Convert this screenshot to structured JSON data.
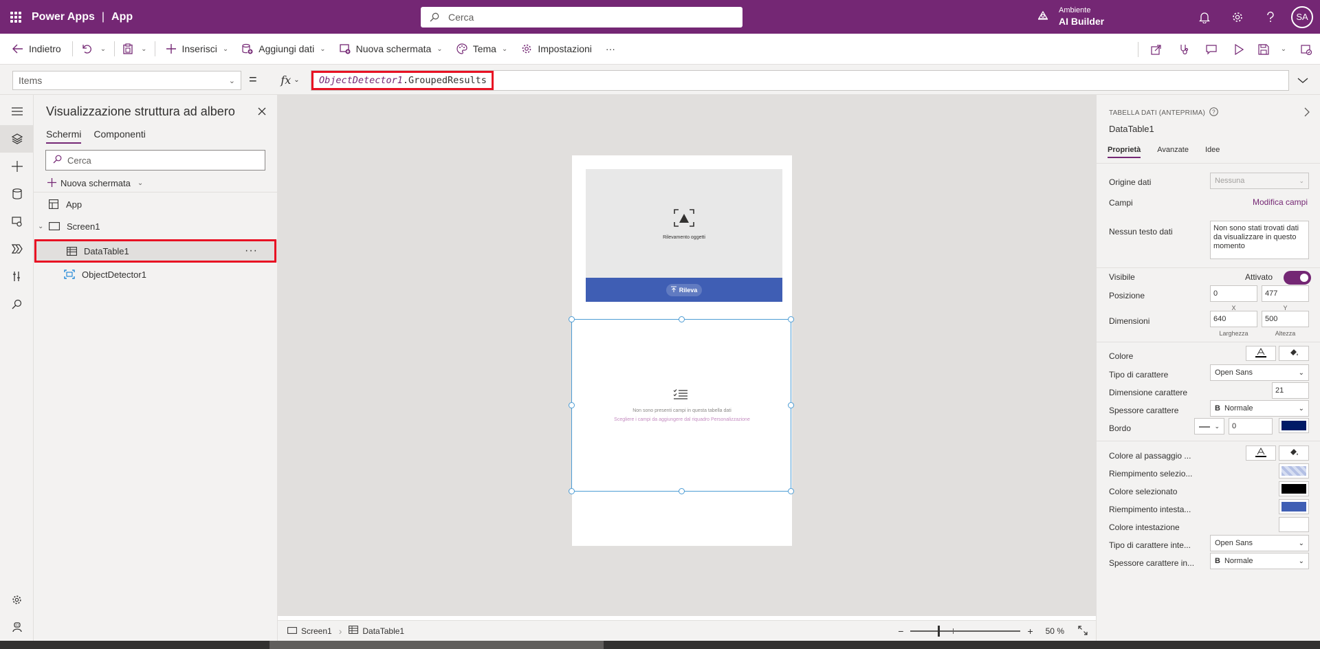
{
  "header": {
    "product": "Power Apps",
    "separator": "|",
    "app": "App",
    "search_placeholder": "Cerca",
    "environment_label": "Ambiente",
    "environment_name": "AI Builder",
    "user_initials": "SA"
  },
  "command_bar": {
    "back": "Indietro",
    "insert": "Inserisci",
    "add_data": "Aggiungi dati",
    "new_screen": "Nuova schermata",
    "theme": "Tema",
    "settings": "Impostazioni",
    "more": "···"
  },
  "formula_bar": {
    "property": "Items",
    "equals": "=",
    "fx": "fx",
    "formula_object": "ObjectDetector1",
    "formula_member": ".GroupedResults"
  },
  "tree": {
    "title": "Visualizzazione struttura ad albero",
    "tabs": [
      "Schermi",
      "Componenti"
    ],
    "search_placeholder": "Cerca",
    "new_screen": "Nuova schermata",
    "items": [
      {
        "label": "App"
      },
      {
        "label": "Screen1"
      },
      {
        "label": "DataTable1"
      },
      {
        "label": "ObjectDetector1"
      }
    ],
    "more": "···"
  },
  "canvas": {
    "detector_label": "Rilevamento oggetti",
    "detect_button": "Rileva",
    "empty_line1": "Non sono presenti campi in questa tabella dati",
    "empty_line2": "Scegliere i campi da aggiungere dal riquadro Personalizzazione"
  },
  "status_bar": {
    "screen": "Screen1",
    "control": "DataTable1",
    "zoom_minus": "−",
    "zoom_plus": "+",
    "zoom_value": "50",
    "zoom_unit": "%"
  },
  "properties": {
    "kind": "TABELLA DATI (ANTEPRIMA)",
    "name": "DataTable1",
    "tabs": [
      "Proprietà",
      "Avanzate",
      "Idee"
    ],
    "data_source_label": "Origine dati",
    "data_source_value": "Nessuna",
    "fields_label": "Campi",
    "fields_link": "Modifica campi",
    "no_data_label": "Nessun testo dati",
    "no_data_value": "Non sono stati trovati dati da visualizzare in questo momento",
    "visible_label": "Visibile",
    "visible_value": "Attivato",
    "position_label": "Posizione",
    "pos_x": "0",
    "pos_y": "477",
    "x_label": "X",
    "y_label": "Y",
    "size_label": "Dimensioni",
    "width": "640",
    "height": "500",
    "width_label": "Larghezza",
    "height_label": "Altezza",
    "color_label": "Colore",
    "font_label": "Tipo di carattere",
    "font_value": "Open Sans",
    "font_size_label": "Dimensione carattere",
    "font_size_value": "21",
    "font_weight_label": "Spessore carattere",
    "font_weight_value": "Normale",
    "border_label": "Bordo",
    "border_value": "0",
    "hover_color_label": "Colore al passaggio ...",
    "selection_fill_label": "Riempimento selezio...",
    "selected_color_label": "Colore selezionato",
    "header_fill_label": "Riempimento intesta...",
    "header_color_label": "Colore intestazione",
    "header_font_label": "Tipo di carattere inte...",
    "header_font_value": "Open Sans",
    "header_weight_label": "Spessore carattere in...",
    "header_weight_value": "Normale"
  },
  "colors": {
    "brand": "#742774",
    "highlight": "#e81123",
    "border_color_swatch": "#001a66",
    "selected_color_swatch": "#000000",
    "header_fill_swatch": "#3f5eb4",
    "button_blue": "#3f5eb4"
  }
}
